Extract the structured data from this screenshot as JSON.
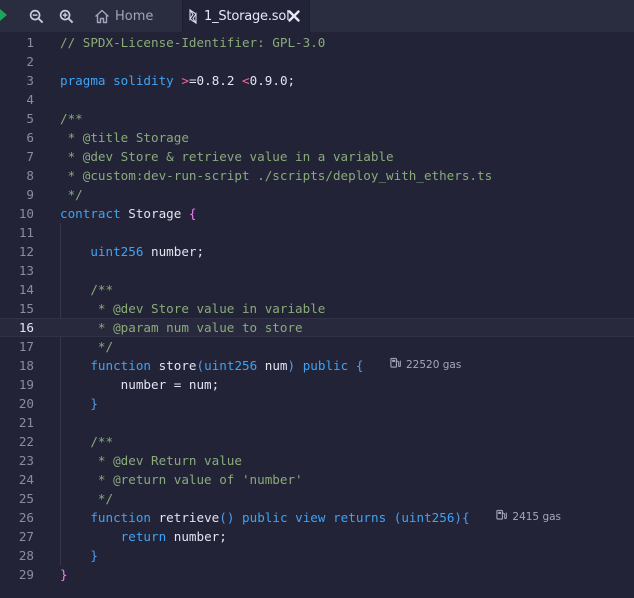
{
  "tabs": {
    "home_label": "Home",
    "file_label": "1_Storage.sol"
  },
  "toolbar": {
    "zoom_out_icon": "zoom-out-icon",
    "zoom_in_icon": "zoom-in-icon"
  },
  "editor": {
    "active_line": "16",
    "lines": [
      {
        "n": "1",
        "text": "// SPDX-License-Identifier: GPL-3.0"
      },
      {
        "n": "2",
        "text": ""
      },
      {
        "n": "3",
        "text": "pragma solidity >=0.8.2 <0.9.0;"
      },
      {
        "n": "4",
        "text": ""
      },
      {
        "n": "5",
        "text": "/**"
      },
      {
        "n": "6",
        "text": " * @title Storage"
      },
      {
        "n": "7",
        "text": " * @dev Store & retrieve value in a variable"
      },
      {
        "n": "8",
        "text": " * @custom:dev-run-script ./scripts/deploy_with_ethers.ts"
      },
      {
        "n": "9",
        "text": " */"
      },
      {
        "n": "10",
        "text": "contract Storage {"
      },
      {
        "n": "11",
        "text": ""
      },
      {
        "n": "12",
        "text": "    uint256 number;"
      },
      {
        "n": "13",
        "text": ""
      },
      {
        "n": "14",
        "text": "    /**"
      },
      {
        "n": "15",
        "text": "     * @dev Store value in variable"
      },
      {
        "n": "16",
        "text": "     * @param num value to store"
      },
      {
        "n": "17",
        "text": "     */"
      },
      {
        "n": "18",
        "text": "    function store(uint256 num) public {"
      },
      {
        "n": "19",
        "text": "        number = num;"
      },
      {
        "n": "20",
        "text": "    }"
      },
      {
        "n": "21",
        "text": ""
      },
      {
        "n": "22",
        "text": "    /**"
      },
      {
        "n": "23",
        "text": "     * @dev Return value"
      },
      {
        "n": "24",
        "text": "     * @return value of 'number'"
      },
      {
        "n": "25",
        "text": "     */"
      },
      {
        "n": "26",
        "text": "    function retrieve() public view returns (uint256){"
      },
      {
        "n": "27",
        "text": "        return number;"
      },
      {
        "n": "28",
        "text": "    }"
      },
      {
        "n": "29",
        "text": "}"
      }
    ],
    "gas_hints": [
      {
        "line": "18",
        "label": "22520 gas"
      },
      {
        "line": "26",
        "label": "2415 gas"
      }
    ]
  },
  "colors": {
    "background": "#222336",
    "tabbar": "#2a2c3f",
    "comment": "#8aab7a",
    "keyword": "#3fa3f5",
    "operator": "#f26b9b",
    "bracket_outer": "#ee7ff0",
    "bracket_inner": "#4f9ef4",
    "run_arrow": "#1ea55b"
  }
}
